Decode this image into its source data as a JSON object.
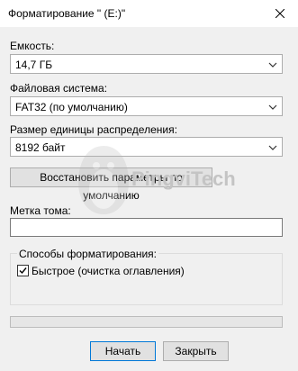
{
  "window": {
    "title": "Форматирование \" (E:)\""
  },
  "capacity": {
    "label": "Емкость:",
    "value": "14,7 ГБ"
  },
  "filesystem": {
    "label": "Файловая система:",
    "value": "FAT32 (по умолчанию)"
  },
  "allocation": {
    "label": "Размер единицы распределения:",
    "value": "8192 байт"
  },
  "restore_defaults_label": "Восстановить параметры по умолчанию",
  "volume_label": {
    "label": "Метка тома:",
    "value": ""
  },
  "format_options": {
    "title": "Способы форматирования:",
    "quick_format_label": "Быстрое (очистка оглавления)",
    "quick_format_checked": true
  },
  "progress": {
    "value": 0
  },
  "buttons": {
    "start_label": "Начать",
    "close_label": "Закрыть"
  },
  "watermark": {
    "text": "PingviTech"
  }
}
